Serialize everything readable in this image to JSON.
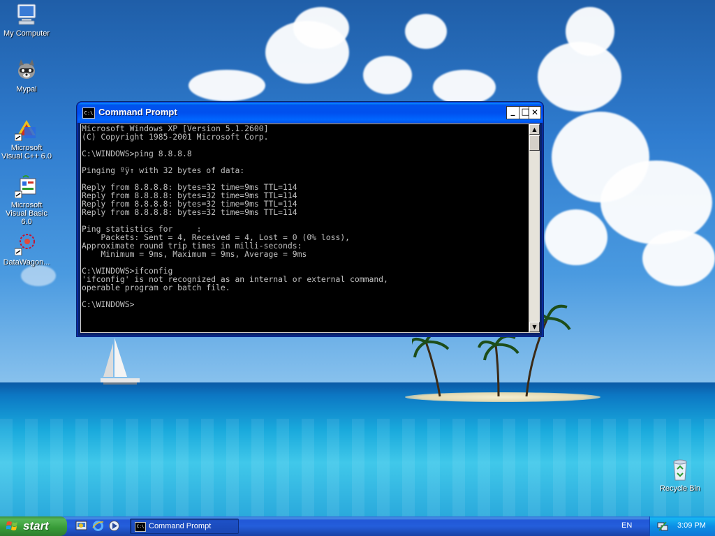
{
  "desktop": {
    "icons": [
      {
        "label": "My Computer",
        "icon": "my-computer-icon"
      },
      {
        "label": "Mypal",
        "icon": "raccoon-icon"
      },
      {
        "label": "Microsoft Visual C++ 6.0",
        "icon": "visual-cpp-icon"
      },
      {
        "label": "Microsoft Visual Basic 6.0",
        "icon": "visual-basic-icon"
      },
      {
        "label": "DataWagon...",
        "icon": "datawagon-icon"
      },
      {
        "label": "Recycle Bin",
        "icon": "recycle-bin-icon"
      }
    ]
  },
  "window": {
    "title": "Command Prompt",
    "icon_text": "C:\\",
    "minimize_glyph": "_",
    "maximize_glyph": "□",
    "close_glyph": "✕",
    "console_text": "Microsoft Windows XP [Version 5.1.2600]\n(C) Copyright 1985-2001 Microsoft Corp.\n\nC:\\WINDOWS>ping 8.8.8.8\n\nPinging ºÿ↑ with 32 bytes of data:\n\nReply from 8.8.8.8: bytes=32 time=9ms TTL=114\nReply from 8.8.8.8: bytes=32 time=9ms TTL=114\nReply from 8.8.8.8: bytes=32 time=9ms TTL=114\nReply from 8.8.8.8: bytes=32 time=9ms TTL=114\n\nPing statistics for     :\n    Packets: Sent = 4, Received = 4, Lost = 0 (0% loss),\nApproximate round trip times in milli-seconds:\n    Minimum = 9ms, Maximum = 9ms, Average = 9ms\n\nC:\\WINDOWS>ifconfig\n'ifconfig' is not recognized as an internal or external command,\noperable program or batch file.\n\nC:\\WINDOWS>",
    "scroll_up_glyph": "▲",
    "scroll_down_glyph": "▼"
  },
  "taskbar": {
    "start_label": "start",
    "quick_launch": [
      "show-desktop-icon",
      "internet-explorer-icon",
      "media-player-icon"
    ],
    "tasks": [
      {
        "label": "Command Prompt",
        "icon_text": "C:\\"
      }
    ],
    "language": "EN",
    "clock": "3:09 PM"
  },
  "colors": {
    "console_bg": "#000000",
    "console_fg": "#c0c0c0",
    "titlebar": "#0053ee",
    "taskbar": "#245edb",
    "start_green": "#379a37"
  }
}
